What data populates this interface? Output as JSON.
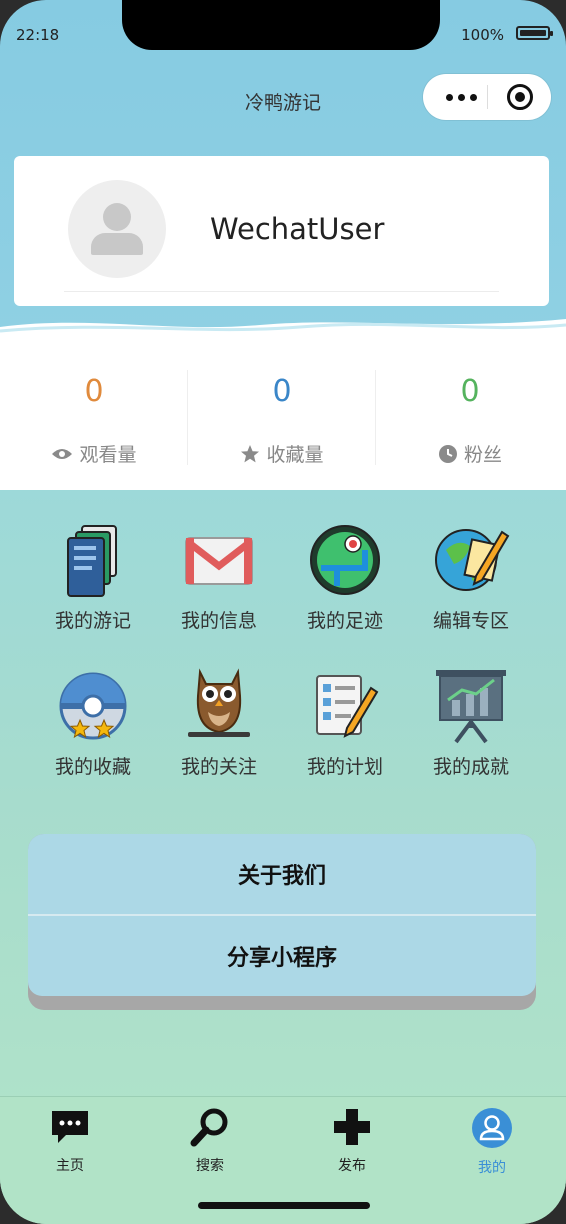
{
  "status_bar": {
    "time": "22:18",
    "battery_text": "100%"
  },
  "navbar": {
    "title": "冷鸭游记"
  },
  "profile": {
    "username": "WechatUser"
  },
  "stats": [
    {
      "value": "0",
      "label": "观看量",
      "icon": "eye-icon",
      "color": "#e08a3c"
    },
    {
      "value": "0",
      "label": "收藏量",
      "icon": "star-icon",
      "color": "#3a86c8"
    },
    {
      "value": "0",
      "label": "粉丝",
      "icon": "clock-icon",
      "color": "#55b35e"
    }
  ],
  "grid": [
    {
      "label": "我的游记",
      "icon": "notebook-icon"
    },
    {
      "label": "我的信息",
      "icon": "mail-icon"
    },
    {
      "label": "我的足迹",
      "icon": "map-icon"
    },
    {
      "label": "编辑专区",
      "icon": "globe-pencil-icon"
    },
    {
      "label": "我的收藏",
      "icon": "pokeball-icon"
    },
    {
      "label": "我的关注",
      "icon": "owl-icon"
    },
    {
      "label": "我的计划",
      "icon": "checklist-icon"
    },
    {
      "label": "我的成就",
      "icon": "chart-board-icon"
    }
  ],
  "buttons": {
    "about": "关于我们",
    "share": "分享小程序"
  },
  "tabbar": [
    {
      "label": "主页",
      "icon": "chat-icon"
    },
    {
      "label": "搜索",
      "icon": "search-icon"
    },
    {
      "label": "发布",
      "icon": "plus-icon"
    },
    {
      "label": "我的",
      "icon": "user-icon",
      "active": true
    }
  ]
}
